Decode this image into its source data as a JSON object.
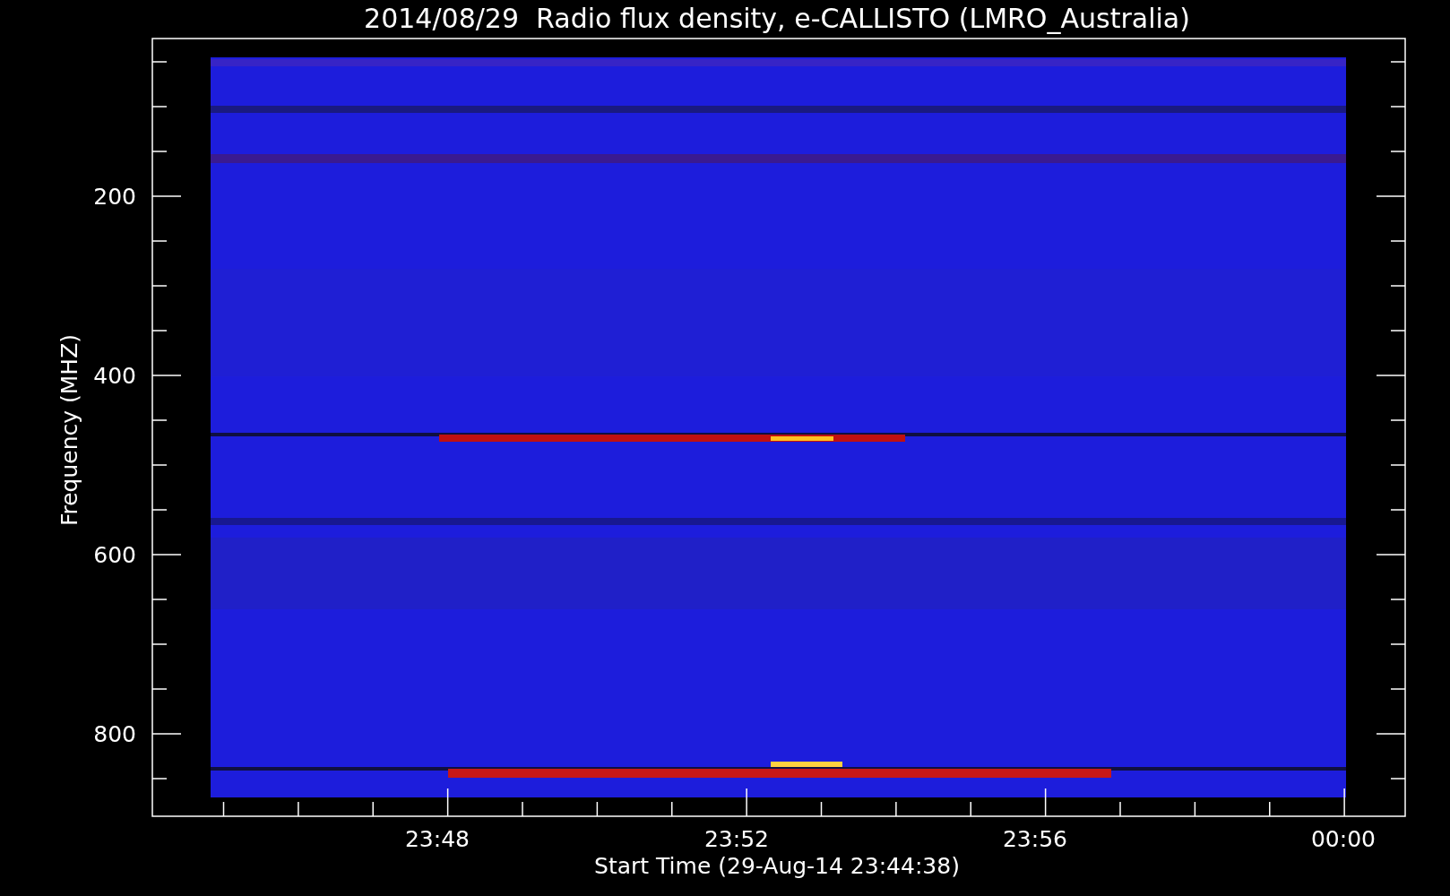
{
  "title": "2014/08/29  Radio flux density, e-CALLISTO (LMRO_Australia)",
  "y_axis": {
    "label": "Frequency (MHZ)",
    "ticks": [
      "200",
      "400",
      "600",
      "800"
    ]
  },
  "x_axis": {
    "label": "Start Time (29-Aug-14 23:44:38)",
    "ticks": [
      "23:48",
      "23:52",
      "23:56",
      "00:00"
    ]
  }
}
